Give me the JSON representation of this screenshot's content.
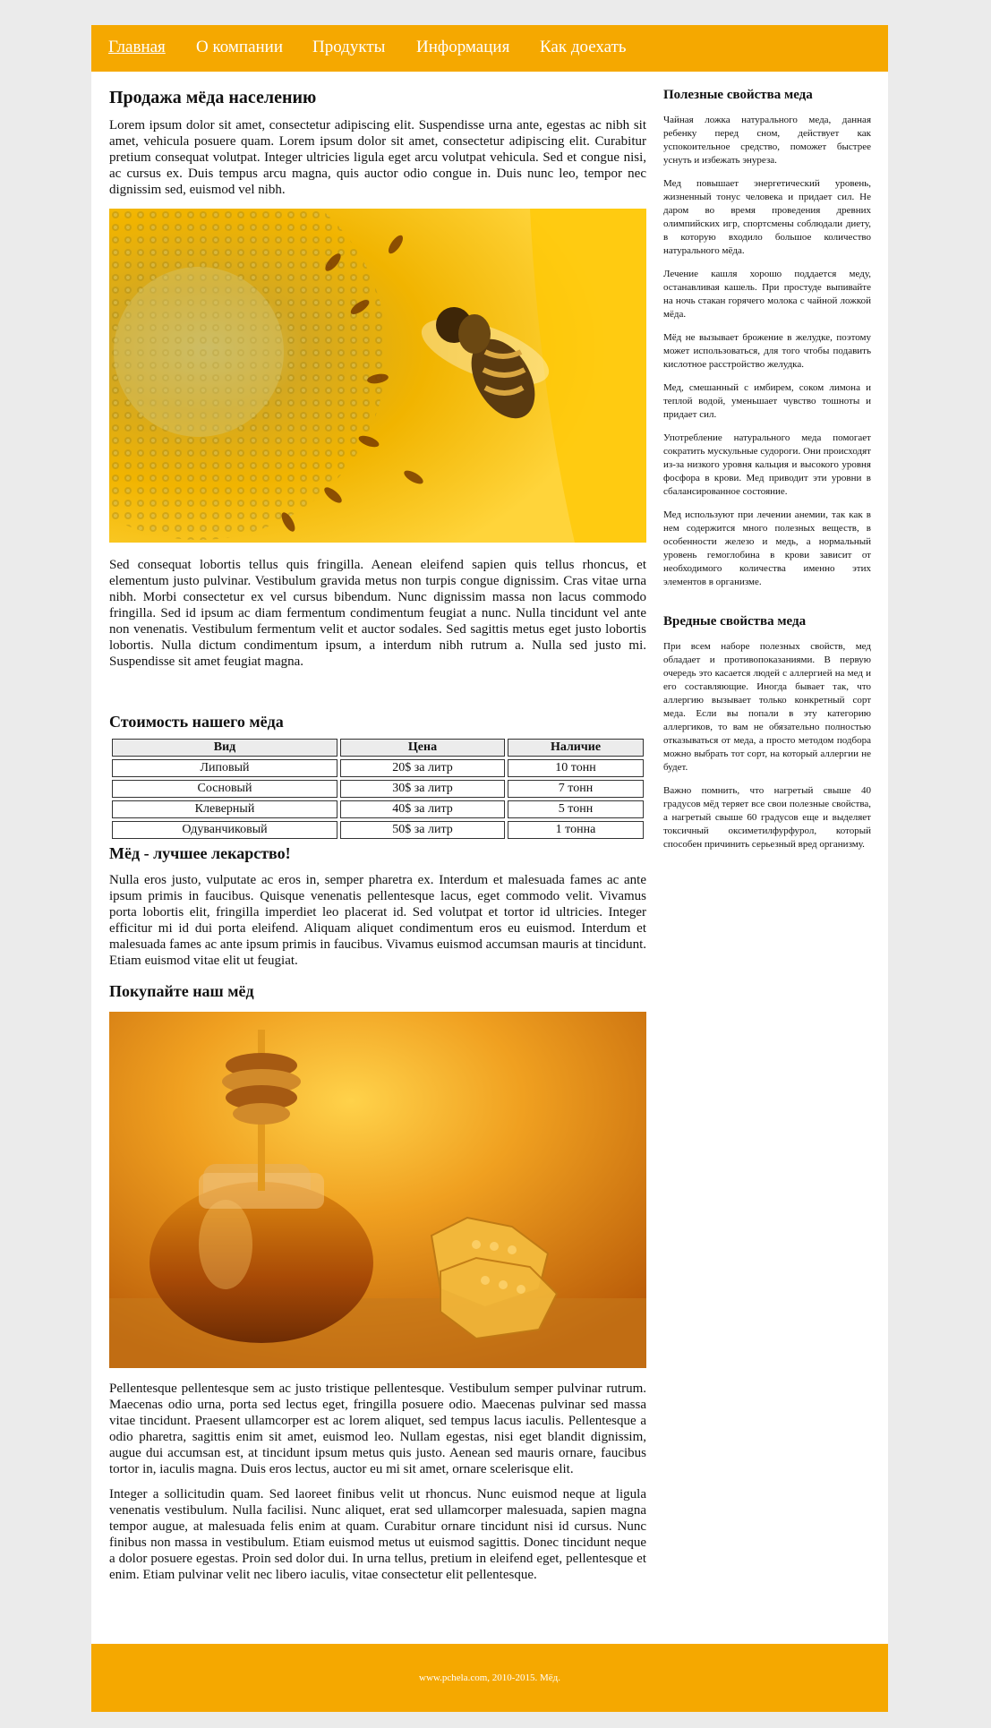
{
  "nav": {
    "items": [
      {
        "label": "Главная"
      },
      {
        "label": "О компании"
      },
      {
        "label": "Продукты"
      },
      {
        "label": "Информация"
      },
      {
        "label": "Как доехать"
      }
    ]
  },
  "main": {
    "title": "Продажа мёда населению",
    "intro": "Lorem ipsum dolor sit amet, consectetur adipiscing elit. Suspendisse urna ante, egestas ac nibh sit amet, vehicula posuere quam. Lorem ipsum dolor sit amet, consectetur adipiscing elit. Curabitur pretium consequat volutpat. Integer ultricies ligula eget arcu volutpat vehicula. Sed et congue nisi, ac cursus ex. Duis tempus arcu magna, quis auctor odio congue in. Duis nunc leo, tempor nec dignissim sed, euismod vel nibh.",
    "bee_image": "bee-on-sunflower-photo",
    "text2": "Sed consequat lobortis tellus quis fringilla. Aenean eleifend sapien quis tellus rhoncus, et elementum justo pulvinar. Vestibulum gravida metus non turpis congue dignissim. Cras vitae urna nibh. Morbi consectetur ex vel cursus bibendum. Nunc dignissim massa non lacus commodo fringilla. Sed id ipsum ac diam fermentum condimentum feugiat a nunc. Nulla tincidunt vel ante non venenatis. Vestibulum fermentum velit et auctor sodales. Sed sagittis metus eget justo lobortis lobortis. Nulla dictum condimentum ipsum, a interdum nibh rutrum a. Nulla sed justo mi. Suspendisse sit amet feugiat magna.",
    "price_heading": "Стоимость нашего мёда",
    "table": {
      "headers": [
        "Вид",
        "Цена",
        "Наличие"
      ],
      "rows": [
        [
          "Липовый",
          "20$ за литр",
          "10 тонн"
        ],
        [
          "Сосновый",
          "30$ за литр",
          "7 тонн"
        ],
        [
          "Клеверный",
          "40$ за литр",
          "5 тонн"
        ],
        [
          "Одуванчиковый",
          "50$ за литр",
          "1 тонна"
        ]
      ]
    },
    "medicine_heading": "Мёд - лучшее лекарство!",
    "text3": "Nulla eros justo, vulputate ac eros in, semper pharetra ex. Interdum et malesuada fames ac ante ipsum primis in faucibus. Quisque venenatis pellentesque lacus, eget commodo velit. Vivamus porta lobortis elit, fringilla imperdiet leo placerat id. Sed volutpat et tortor id ultricies. Integer efficitur mi id dui porta eleifend. Aliquam aliquet condimentum eros eu euismod. Interdum et malesuada fames ac ante ipsum primis in faucibus. Vivamus euismod accumsan mauris at tincidunt. Etiam euismod vitae elit ut feugiat.",
    "buy_heading": "Покупайте наш мёд",
    "honey_image": "honey-jar-with-dipper-and-honeycomb-photo",
    "text4": "Pellentesque pellentesque sem ac justo tristique pellentesque. Vestibulum semper pulvinar rutrum. Maecenas odio urna, porta sed lectus eget, fringilla posuere odio. Maecenas pulvinar sed massa vitae tincidunt. Praesent ullamcorper est ac lorem aliquet, sed tempus lacus iaculis. Pellentesque a odio pharetra, sagittis enim sit amet, euismod leo. Nullam egestas, nisi eget blandit dignissim, augue dui accumsan est, at tincidunt ipsum metus quis justo. Aenean sed mauris ornare, faucibus tortor in, iaculis magna. Duis eros lectus, auctor eu mi sit amet, ornare scelerisque elit.",
    "text5": "Integer a sollicitudin quam. Sed laoreet finibus velit ut rhoncus. Nunc euismod neque at ligula venenatis vestibulum. Nulla facilisi. Nunc aliquet, erat sed ullamcorper malesuada, sapien magna tempor augue, at malesuada felis enim at quam. Curabitur ornare tincidunt nisi id cursus. Nunc finibus non massa in vestibulum. Etiam euismod metus ut euismod sagittis. Donec tincidunt neque a dolor posuere egestas. Proin sed dolor dui. In urna tellus, pretium in eleifend eget, pellentesque et enim. Etiam pulvinar velit nec libero iaculis, vitae consectetur elit pellentesque."
  },
  "sidebar": {
    "useful_heading": "Полезные свойства меда",
    "useful": [
      "Чайная ложка натурального меда, данная ребенку перед сном, действует как успокоительное средство, поможет быстрее уснуть и избежать энуреза.",
      "Мед повышает энергетический уровень, жизненный тонус человека и придает сил. Не даром во время проведения древних олимпийских игр, спортсмены соблюдали диету, в которую входило большое количество натурального мёда.",
      "Лечение кашля хорошо поддается меду, останавливая кашель. При простуде выпивайте на ночь стакан горячего молока с чайной ложкой мёда.",
      "Мёд не вызывает брожение в желудке, поэтому может использоваться, для того чтобы подавить кислотное расстройство желудка.",
      "Мед, смешанный с имбирем, соком лимона и теплой водой, уменьшает чувство тошноты и придает сил.",
      "Употребление натурального меда помогает сократить мускульные судороги. Они происходят из-за низкого уровня кальция и высокого уровня фосфора в крови. Мед приводит эти уровни в сбалансированное состояние.",
      "Мед используют при лечении анемии, так как в нем содержится много полезных веществ, в особенности железо и медь, а нормальный уровень гемоглобина в крови зависит от необходимого количества именно этих элементов в организме."
    ],
    "harmful_heading": "Вредные свойства меда",
    "harmful": [
      "При всем наборе полезных свойств, мед обладает и противопоказаниями. В первую очередь это касается людей с аллергией на мед и его составляющие. Иногда бывает так, что аллергию вызывает только конкретный сорт меда. Если вы попали в эту категорию аллергиков, то вам не обязательно полностью отказываться от меда, а просто методом подбора можно выбрать тот сорт, на который аллергии не будет.",
      "Важно помнить, что нагретый свыше 40 градусов мёд теряет все свои полезные свойства, а нагретый свыше 60 градусов еще и выделяет токсичный оксиметилфурфурол, который способен причинить серьезный вред организму."
    ]
  },
  "footer": {
    "text": "www.pchela.com, 2010-2015. Мёд."
  },
  "colors": {
    "accent": "#f5a800",
    "background": "#ebebeb"
  }
}
